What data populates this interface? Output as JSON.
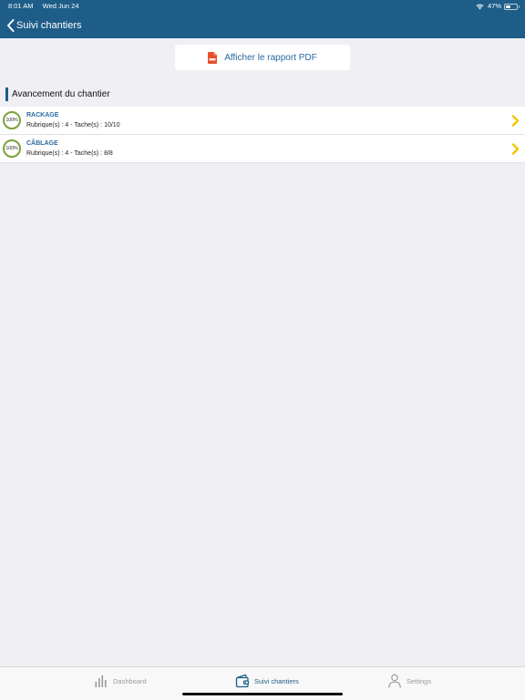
{
  "status_bar": {
    "time": "8:01 AM",
    "date": "Wed Jun 24",
    "battery_pct": "47%",
    "battery_level": 0.47
  },
  "navbar": {
    "back_label": "Suivi chantiers"
  },
  "pdf_button": {
    "label": "Afficher le rapport PDF"
  },
  "section": {
    "title": "Avancement du chantier"
  },
  "items": [
    {
      "progress": "100%",
      "title": "RACKAGE",
      "subtitle": "Rubrique(s) : 4 - Tache(s) : 10/10"
    },
    {
      "progress": "100%",
      "title": "CÂBLAGE",
      "subtitle": "Rubrique(s) : 4 - Tache(s) : 8/8"
    }
  ],
  "tabbar": {
    "dashboard": "Dashboard",
    "suivi": "Suivi chantiers",
    "settings": "Settings"
  },
  "colors": {
    "nav": "#1d5d88",
    "accent": "#2b6aa0",
    "progress_ring": "#7aa23c",
    "chevron": "#f5c400",
    "pdf": "#e8502a"
  }
}
